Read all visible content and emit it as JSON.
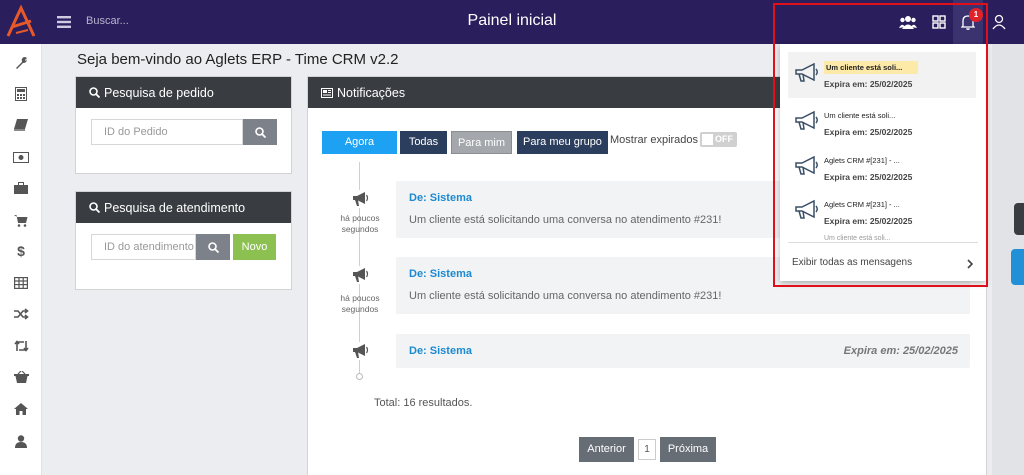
{
  "header": {
    "search_placeholder": "Buscar...",
    "title": "Painel inicial",
    "notification_count": "1"
  },
  "welcome": "Seja bem-vindo ao Aglets ERP - Time CRM v2.2",
  "order_search": {
    "title": "Pesquisa de pedido",
    "placeholder": "ID do Pedido"
  },
  "service_search": {
    "title": "Pesquisa de atendimento",
    "placeholder": "ID do atendimento",
    "new_label": "Novo"
  },
  "notifications": {
    "title": "Notificações",
    "tabs": [
      {
        "label": "Agora",
        "active": true
      },
      {
        "label": "Todas"
      },
      {
        "label": "Para mim"
      },
      {
        "label": "Para meu grupo"
      }
    ],
    "show_expired_label": "Mostrar expirados",
    "toggle_label": "OFF",
    "items": [
      {
        "time": "há poucos segundos",
        "from": "De: Sistema",
        "text": "Um cliente está solicitando uma conversa no atendimento #231!"
      },
      {
        "time": "há poucos segundos",
        "from": "De: Sistema",
        "text": "Um cliente está solicitando uma conversa no atendimento #231!"
      },
      {
        "time": "",
        "from": "De: Sistema",
        "expires": "Expira em: 25/02/2025",
        "text": ""
      }
    ],
    "total": "Total: 16 resultados.",
    "pagination": {
      "prev": "Anterior",
      "page": "1",
      "next": "Próxima"
    }
  },
  "dropdown": {
    "items": [
      {
        "title": "Um cliente está soli...",
        "expires": "Expira em: 25/02/2025"
      },
      {
        "title": "Um cliente está soli...",
        "expires": "Expira em: 25/02/2025"
      },
      {
        "title": "Aglets CRM #[231] - ...",
        "expires": "Expira em: 25/02/2025"
      },
      {
        "title": "Aglets CRM #[231] - ...",
        "expires": "Expira em: 25/02/2025"
      }
    ],
    "peek": "Um cliente está soli...",
    "footer": "Exibir todas as mensagens"
  },
  "colors": {
    "topbar": "#2a1e5c",
    "logo": "#e8592a",
    "active_tab": "#1da1f2",
    "link": "#1c8ad1",
    "badge": "#e0232b",
    "novo": "#8cc152",
    "highlight": "#e0101a"
  },
  "icons": [
    "logo-icon",
    "menu-icon",
    "users-icon",
    "grid-icon",
    "bell-icon",
    "user-icon",
    "wrench-icon",
    "calculator-icon",
    "book-icon",
    "money-icon",
    "briefcase-icon",
    "cart-icon",
    "dollar-icon",
    "table-icon",
    "shuffle-icon",
    "retweet-icon",
    "basket-icon",
    "home-icon",
    "person-icon",
    "search-icon",
    "megaphone-icon",
    "chevron-right-icon"
  ]
}
